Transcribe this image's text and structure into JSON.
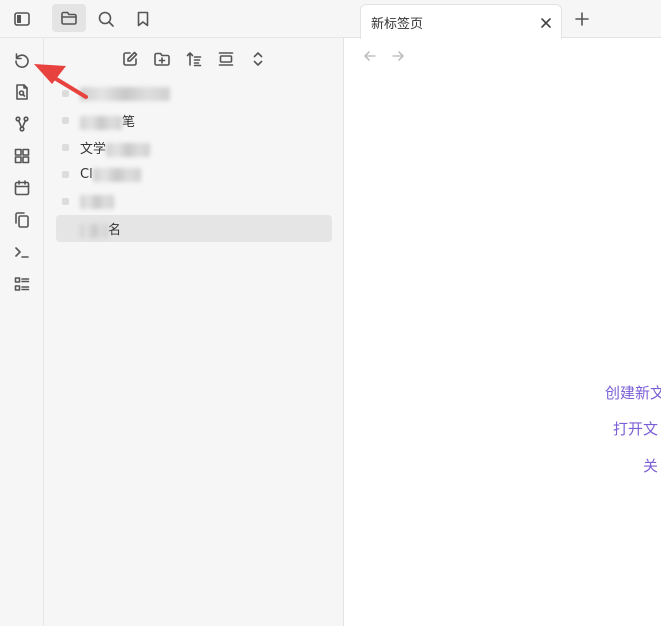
{
  "header": {
    "sidebar_toggle_icon": "sidebar-toggle-icon",
    "tabs": [
      {
        "icon": "folder-icon",
        "active": true
      },
      {
        "icon": "search-icon",
        "active": false
      },
      {
        "icon": "bookmark-icon",
        "active": false
      }
    ]
  },
  "ribbon": {
    "items": [
      {
        "icon": "undo-icon"
      },
      {
        "icon": "search-file-icon"
      },
      {
        "icon": "graph-icon"
      },
      {
        "icon": "grid-icon"
      },
      {
        "icon": "calendar-icon"
      },
      {
        "icon": "copy-icon"
      },
      {
        "icon": "terminal-icon"
      },
      {
        "icon": "list-icon"
      }
    ]
  },
  "file_toolbar": {
    "items": [
      {
        "icon": "new-note-icon"
      },
      {
        "icon": "new-folder-icon"
      },
      {
        "icon": "sort-icon"
      },
      {
        "icon": "collapse-icon"
      },
      {
        "icon": "expand-icon"
      }
    ]
  },
  "file_tree": {
    "items": [
      {
        "visible_text": "",
        "selected": false
      },
      {
        "visible_text": "笔",
        "selected": false
      },
      {
        "visible_text": "文学",
        "selected": false
      },
      {
        "visible_text": "Cl",
        "selected": false
      },
      {
        "visible_text": "",
        "selected": false
      },
      {
        "visible_text": "名",
        "selected": true
      }
    ]
  },
  "editor": {
    "tab_title": "新标签页",
    "empty_state": {
      "create_label": "创建新文",
      "open_label": "打开文",
      "close_label": "关"
    }
  },
  "colors": {
    "accent": "#7b5fd6",
    "annotation_arrow": "#e8423f",
    "sidebar_bg": "#f6f6f6"
  }
}
